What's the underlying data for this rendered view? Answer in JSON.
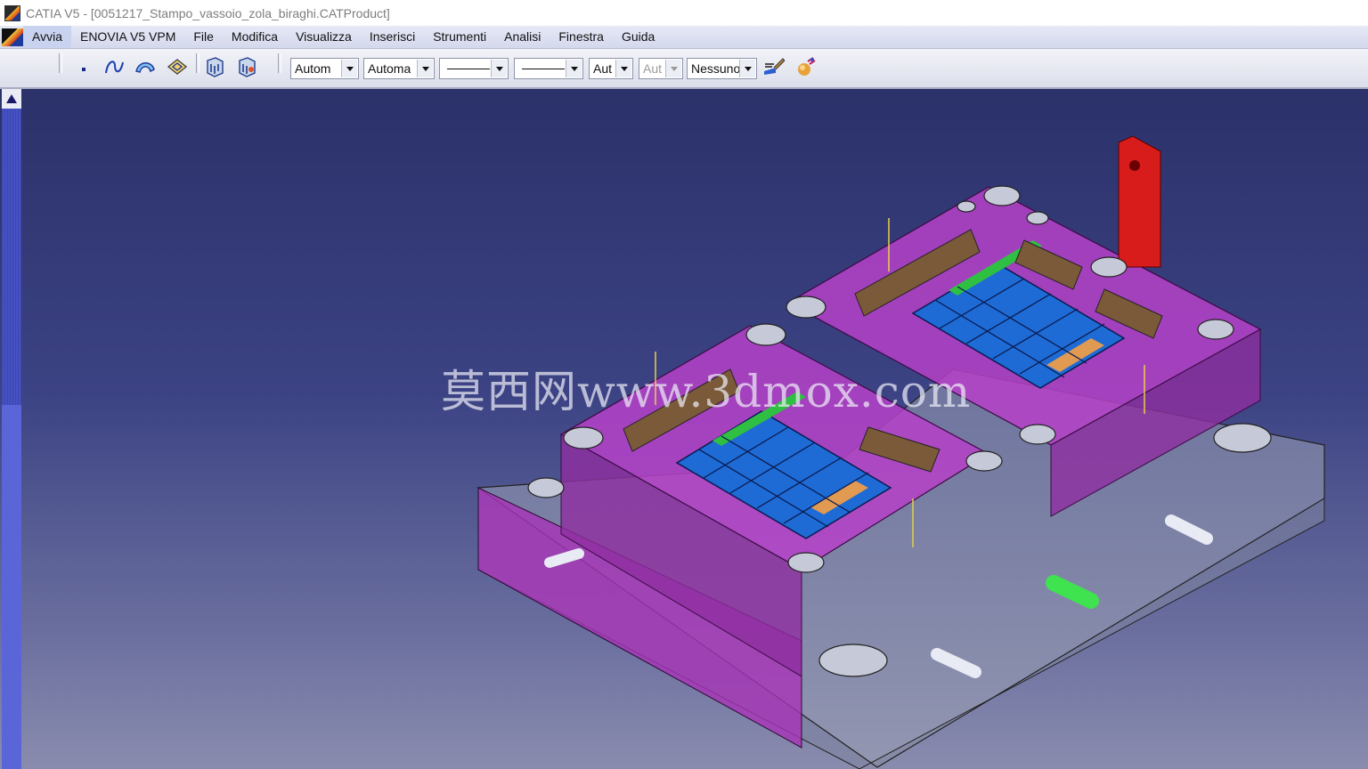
{
  "window": {
    "title": "CATIA V5 - [0051217_Stampo_vassoio_zola_biraghi.CATProduct]",
    "app_icon": "catia-logo-icon"
  },
  "menu": {
    "logo_icon": "catia-logo-icon",
    "items": [
      {
        "label": "Avvia"
      },
      {
        "label": "ENOVIA V5 VPM"
      },
      {
        "label": "File"
      },
      {
        "label": "Modifica"
      },
      {
        "label": "Visualizza"
      },
      {
        "label": "Inserisci"
      },
      {
        "label": "Strumenti"
      },
      {
        "label": "Analisi"
      },
      {
        "label": "Finestra"
      },
      {
        "label": "Guida"
      }
    ]
  },
  "toolbar": {
    "icons": [
      "point-icon",
      "spline-icon",
      "surface-sweep-icon",
      "plane-icon",
      "part-body-icon",
      "part-body-2-icon",
      "brush-icon",
      "apply-material-icon"
    ],
    "combos": [
      {
        "value": "Autom",
        "disabled": false
      },
      {
        "value": "Automa",
        "disabled": false
      },
      {
        "value": "",
        "type": "linetype",
        "disabled": false
      },
      {
        "value": "",
        "type": "lineweight",
        "disabled": false
      },
      {
        "value": "Aut",
        "disabled": false
      },
      {
        "value": "Aut",
        "disabled": true
      },
      {
        "value": "Nessuno",
        "disabled": false
      }
    ]
  },
  "viewport": {
    "watermark": "莫西网www.3dmox.com",
    "colors": {
      "plate_magenta": "#a733b8",
      "insert_blue": "#1e6bd6",
      "stripe_green": "#2fbf43",
      "tab_orange": "#e09a52",
      "handle_red": "#d81b1b",
      "base_grey": "#9aa0b4"
    }
  }
}
